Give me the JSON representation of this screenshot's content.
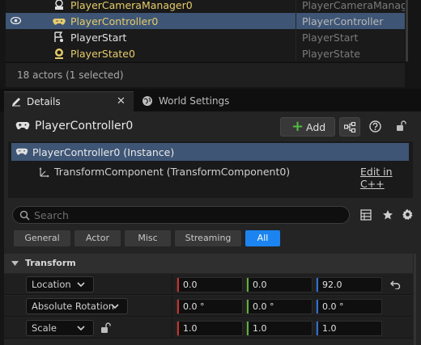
{
  "outliner": {
    "rows": [
      {
        "name": "PlayerCameraManager0",
        "type": "PlayerCameraManage",
        "selected": false,
        "icon": "camera-manager-icon"
      },
      {
        "name": "PlayerController0",
        "type": "PlayerController",
        "selected": true,
        "icon": "gamepad-icon"
      },
      {
        "name": "PlayerStart",
        "type": "PlayerStart",
        "selected": false,
        "icon": "player-start-icon"
      },
      {
        "name": "PlayerState0",
        "type": "PlayerState",
        "selected": false,
        "icon": "player-state-icon"
      }
    ],
    "status": "18 actors (1 selected)"
  },
  "tabs": {
    "details": "Details",
    "details_close": "✕",
    "world_settings": "World Settings"
  },
  "details": {
    "actor_name": "PlayerController0",
    "add_label": "Add",
    "add_plus": "+",
    "components": {
      "root": "PlayerController0 (Instance)",
      "child": "TransformComponent (TransformComponent0)",
      "edit_link": "Edit in C++"
    },
    "search": {
      "placeholder": "Search",
      "value": ""
    },
    "filters": [
      "General",
      "Actor",
      "Misc",
      "Streaming",
      "All"
    ],
    "active_filter": "All",
    "section_title": "Transform",
    "properties": {
      "location": {
        "label": "Location",
        "x": "0.0",
        "y": "0.0",
        "z": "92.0"
      },
      "rotation": {
        "label": "Absolute Rotation",
        "x": "0.0 °",
        "y": "0.0 °",
        "z": "0.0 °"
      },
      "scale": {
        "label": "Scale",
        "x": "1.0",
        "y": "1.0",
        "z": "1.0"
      }
    }
  },
  "colors": {
    "selection": "#3e5575",
    "accent": "#1b84f0",
    "actor_name": "#e6cc6a",
    "axis_x": "#c8342c",
    "axis_y": "#5cb336",
    "axis_z": "#2f6fd6",
    "add_green": "#4fbb3f"
  }
}
